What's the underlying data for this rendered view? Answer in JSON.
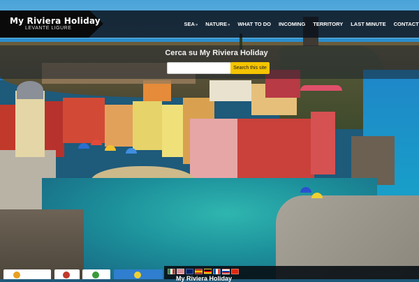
{
  "site": {
    "logo_title": "My Riviera Holiday",
    "logo_subtitle": "LEVANTE LIGURE"
  },
  "nav": {
    "items": [
      {
        "label": "SEA",
        "has_submenu": true
      },
      {
        "label": "NATURE",
        "has_submenu": true
      },
      {
        "label": "WHAT TO DO",
        "has_submenu": false
      },
      {
        "label": "INCOMING",
        "has_submenu": false
      },
      {
        "label": "TERRITORY",
        "has_submenu": false
      },
      {
        "label": "LAST MINUTE",
        "has_submenu": false
      },
      {
        "label": "CONTACTS",
        "has_submenu": false
      }
    ],
    "submenu_glyph": "»"
  },
  "search": {
    "title": "Cerca su My Riviera Holiday",
    "input_value": "",
    "button_label": "Search this site"
  },
  "footer": {
    "title": "My Riviera Holiday",
    "flags": [
      "italy-flag",
      "usa-flag",
      "uk-flag",
      "spain-flag",
      "germany-flag",
      "france-flag",
      "russia-flag",
      "china-flag"
    ]
  },
  "colors": {
    "header_bg": "#0a121c",
    "logo_bg": "#0a0a0a",
    "search_button": "#f5c400",
    "nav_text": "#ffffff"
  }
}
